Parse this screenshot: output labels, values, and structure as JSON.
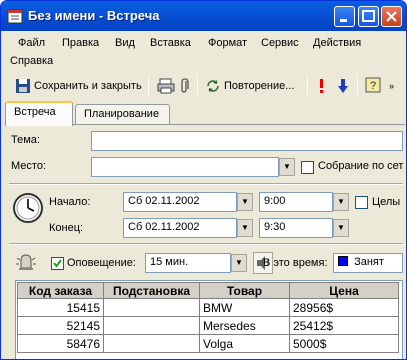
{
  "window": {
    "title": "Без имени - Встреча"
  },
  "menu": [
    "Файл",
    "Правка",
    "Вид",
    "Вставка",
    "Формат",
    "Сервис",
    "Действия",
    "Справка"
  ],
  "toolbar": {
    "save_close": "Сохранить и закрыть",
    "recurrence": "Повторение..."
  },
  "tabs": [
    "Встреча",
    "Планирование"
  ],
  "form": {
    "subject_label": "Тема:",
    "location_label": "Место:",
    "online_meeting": "Собрание по сет",
    "start_label": "Начало:",
    "end_label": "Конец:",
    "start_date": "Сб 02.11.2002",
    "start_time": "9:00",
    "end_date": "Сб 02.11.2002",
    "end_time": "9:30",
    "all_day": "Целы",
    "reminder_label": "Оповещение:",
    "reminder_value": "15 мин.",
    "show_as_label": "В это время:",
    "show_as_value": "Занят"
  },
  "table": {
    "headers": [
      "Код заказа",
      "Подстановка",
      "Товар",
      "Цена"
    ],
    "rows": [
      [
        "15415",
        "",
        "BMW",
        "28956$"
      ],
      [
        "52145",
        "",
        "Mersedes",
        "25412$"
      ],
      [
        "58476",
        "",
        "Volga",
        "5000$"
      ]
    ]
  }
}
